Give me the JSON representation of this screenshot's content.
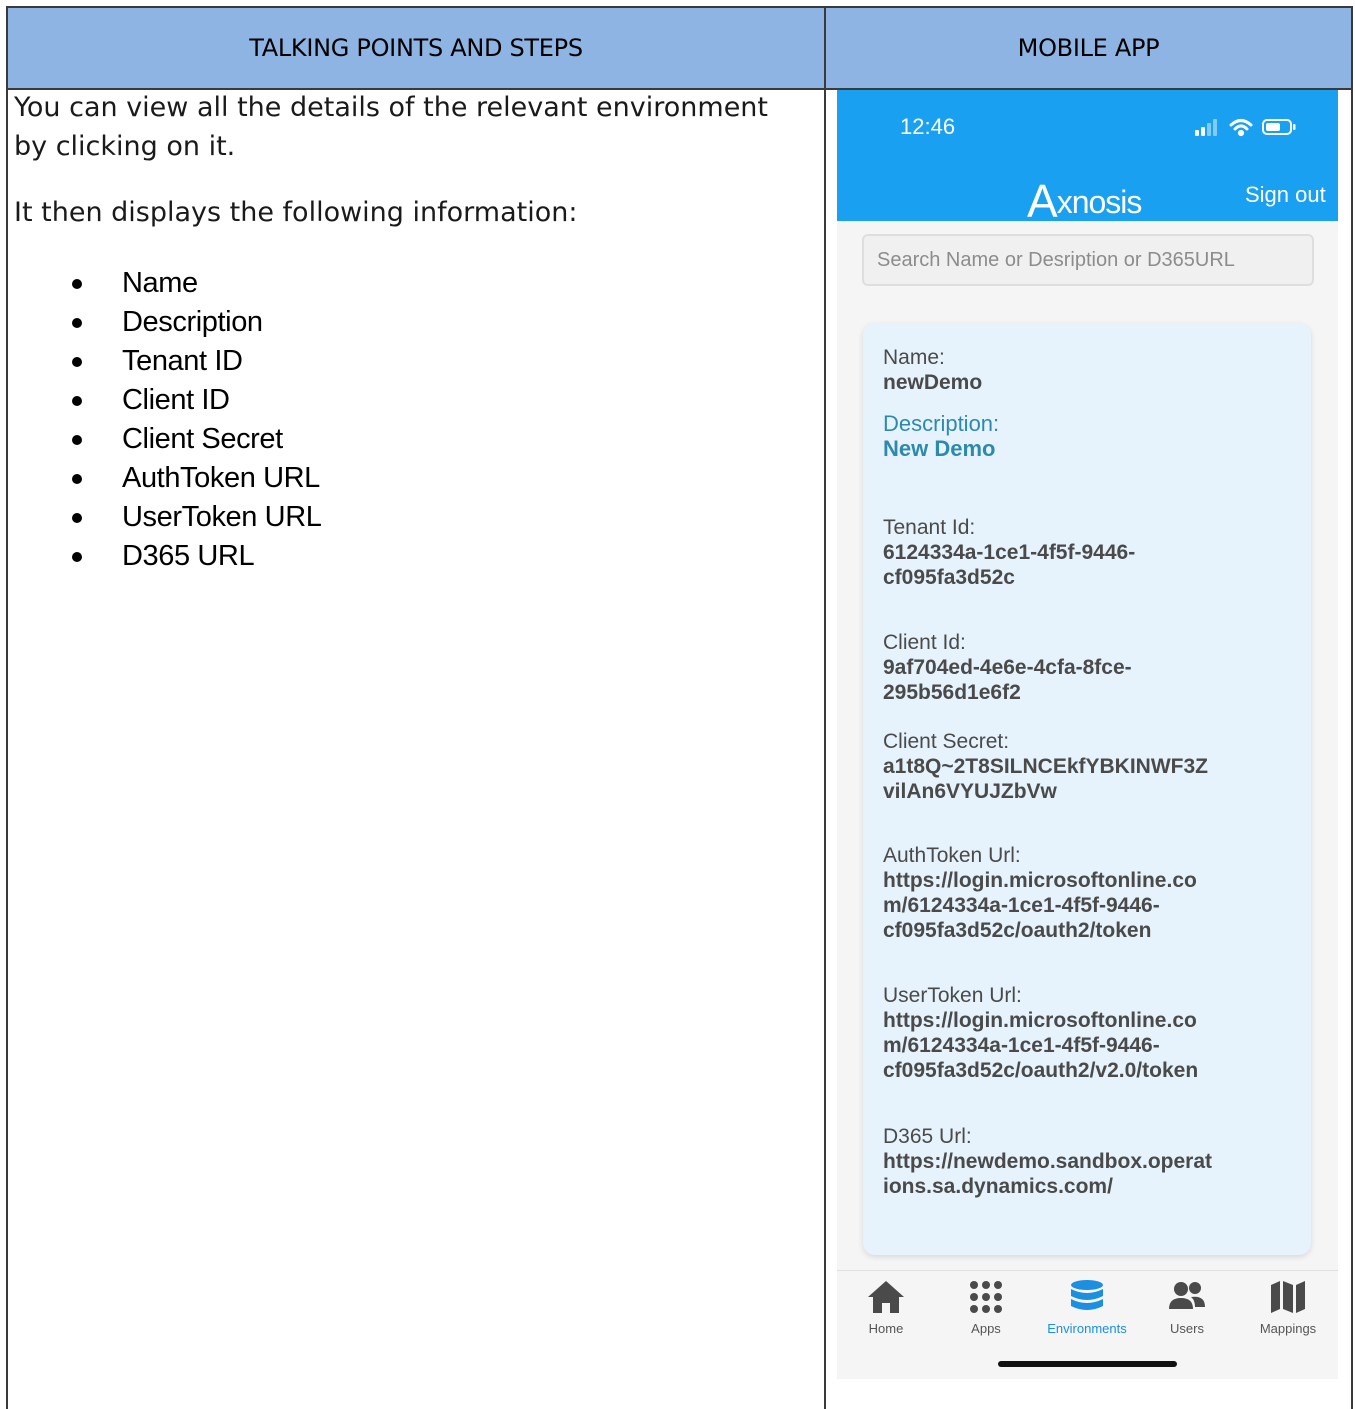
{
  "table": {
    "header_left": "TALKING POINTS AND STEPS",
    "header_right": "MOBILE APP"
  },
  "left": {
    "intro": "You can view all the details of the relevant environment by clicking on it.",
    "intro2": "It then displays the following information:",
    "bullets": [
      "Name",
      "Description",
      "Tenant ID",
      "Client ID",
      "Client Secret",
      "AuthToken URL",
      "UserToken URL",
      "D365 URL"
    ]
  },
  "phone": {
    "time": "12:46",
    "logo": "Axnosis",
    "logo_initial": "A",
    "logo_rest": "xnosis",
    "sign_out": "Sign out",
    "search_placeholder": "Search Name or Desription or D365URL",
    "accent_color": "#1aa0f0",
    "fields": [
      {
        "label": "Name:",
        "value": "newDemo"
      },
      {
        "label": "Description:",
        "value": "New Demo"
      },
      {
        "label": "Tenant Id:",
        "value": "6124334a-1ce1-4f5f-9446-\ncf095fa3d52c"
      },
      {
        "label": "Client Id:",
        "value": "9af704ed-4e6e-4cfa-8fce-\n295b56d1e6f2"
      },
      {
        "label": "Client Secret:",
        "value": "a1t8Q~2T8SILNCEkfYBKINWF3Z\nvilAn6VYUJZbVw"
      },
      {
        "label": "AuthToken Url:",
        "value": "https://login.microsoftonline.co\nm/6124334a-1ce1-4f5f-9446-\ncf095fa3d52c/oauth2/token"
      },
      {
        "label": "UserToken Url:",
        "value": "https://login.microsoftonline.co\nm/6124334a-1ce1-4f5f-9446-\ncf095fa3d52c/oauth2/v2.0/token"
      },
      {
        "label": "D365 Url:",
        "value": "https://newdemo.sandbox.operat\nions.sa.dynamics.com/"
      }
    ],
    "tabs": [
      {
        "label": "Home",
        "icon": "home-icon"
      },
      {
        "label": "Apps",
        "icon": "apps-grid-icon"
      },
      {
        "label": "Environments",
        "icon": "database-icon",
        "active": true
      },
      {
        "label": "Users",
        "icon": "users-icon"
      },
      {
        "label": "Mappings",
        "icon": "map-icon"
      }
    ]
  }
}
